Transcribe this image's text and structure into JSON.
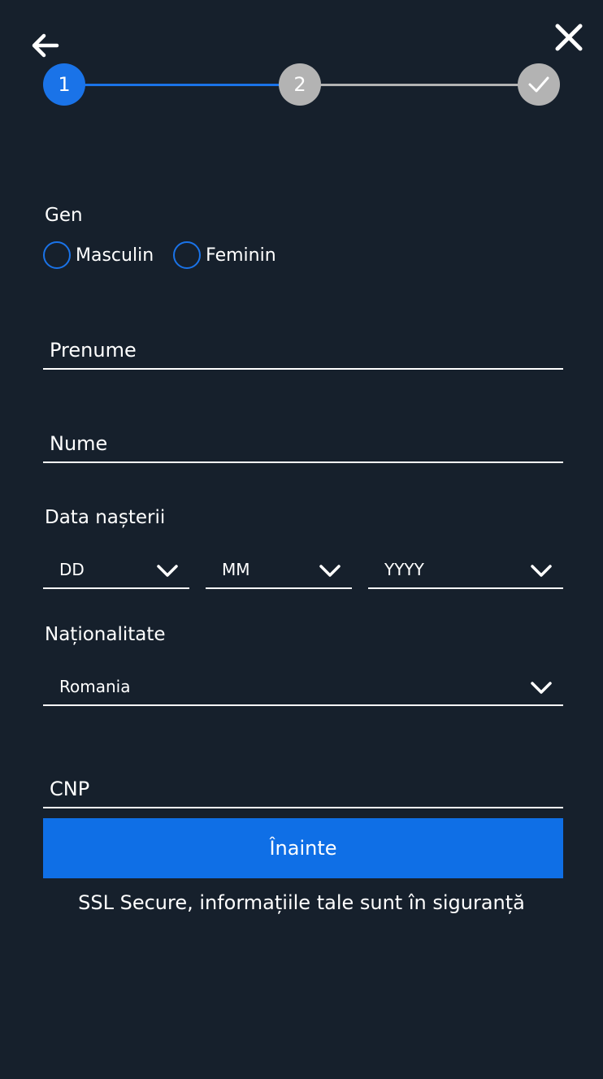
{
  "stepper": {
    "steps": [
      {
        "label": "1",
        "state": "active"
      },
      {
        "label": "2",
        "state": "pending"
      },
      {
        "label": "",
        "state": "final",
        "icon": "check-icon"
      }
    ],
    "active_color": "#1a73e8",
    "inactive_color": "#b3b3b3"
  },
  "gender": {
    "label": "Gen",
    "options": [
      "Masculin",
      "Feminin"
    ]
  },
  "first_name": {
    "placeholder": "Prenume"
  },
  "last_name": {
    "placeholder": "Nume"
  },
  "birth_date": {
    "label": "Data nașterii",
    "day": "DD",
    "month": "MM",
    "year": "YYYY"
  },
  "nationality": {
    "label": "Naționalitate",
    "value": "Romania"
  },
  "cnp": {
    "placeholder": "CNP"
  },
  "submit": {
    "label": "Înainte"
  },
  "ssl_note": "SSL Secure, informațiile tale sunt în siguranță",
  "colors": {
    "background": "#16202c",
    "primary": "#0f6fe6",
    "radio_border": "#1a73e8"
  }
}
